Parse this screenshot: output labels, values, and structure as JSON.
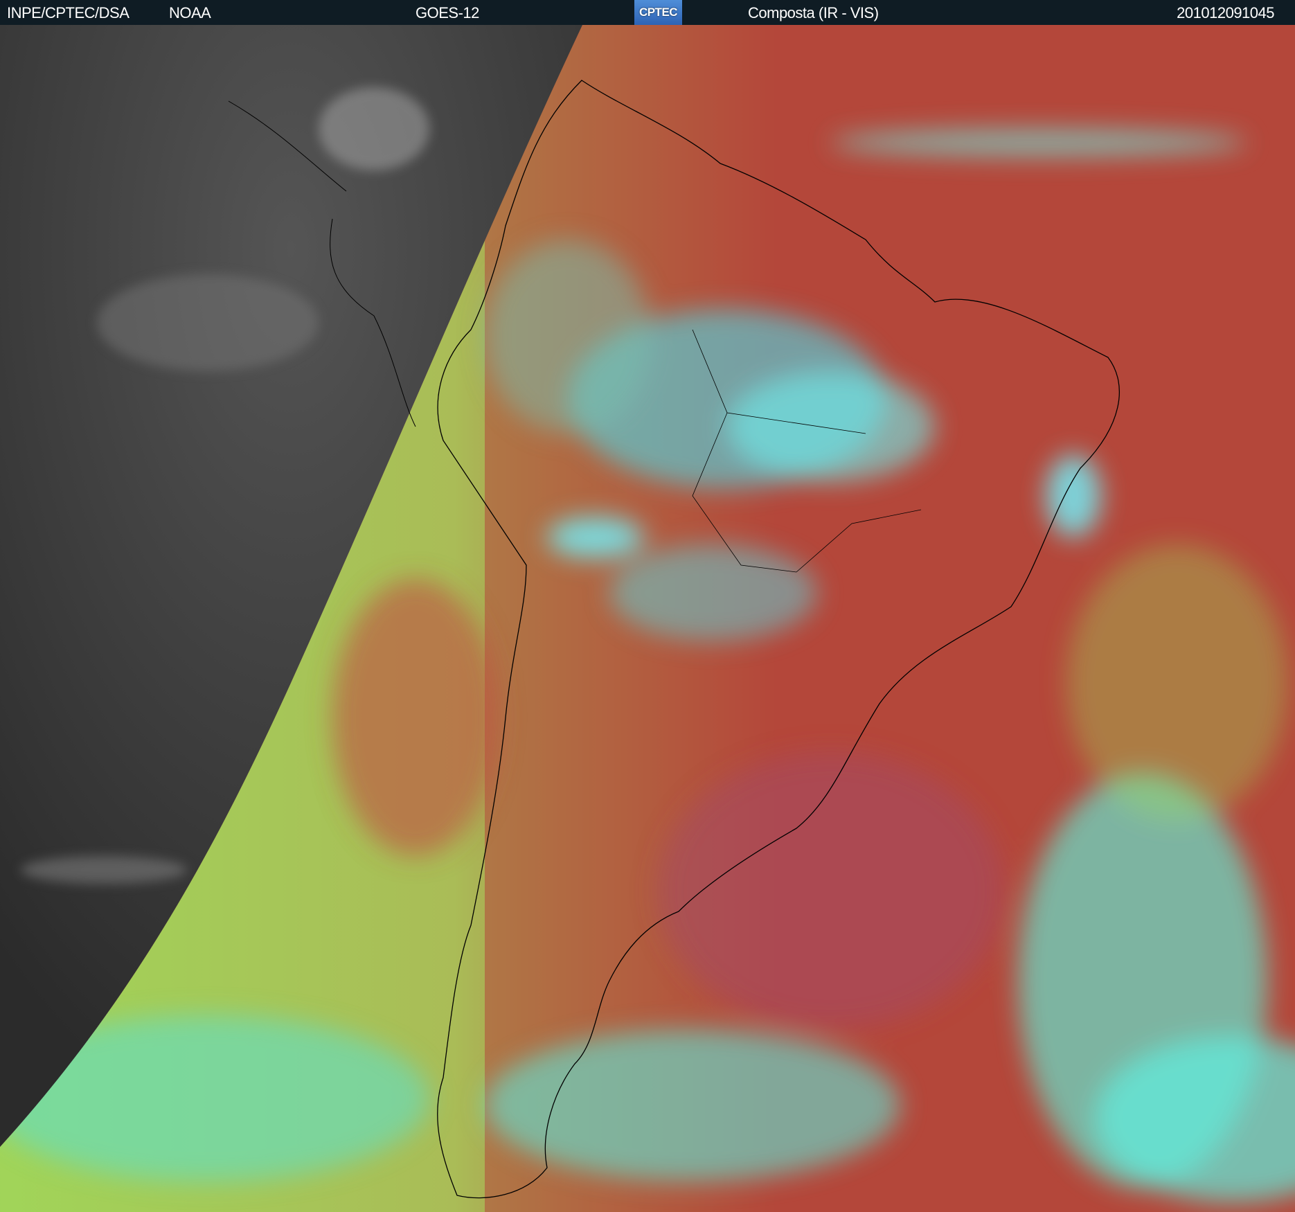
{
  "header": {
    "institution": "INPE/CPTEC/DSA",
    "agency": "NOAA",
    "satellite": "GOES-12",
    "logo_text": "CPTEC",
    "product": "Composta (IR - VIS)",
    "timestamp": "201012091045"
  },
  "colors": {
    "header_bg": "#0f1c24",
    "night_gray": "#3a3a3a",
    "ocean_red": "#b5473a",
    "cloud_cyan": "#4fe8ee",
    "low_cloud_green": "#9ee05a"
  }
}
